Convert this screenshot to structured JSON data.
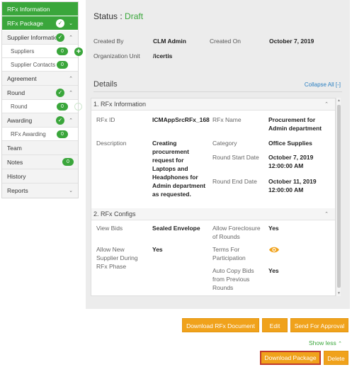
{
  "sidebar": {
    "rfx_information": "RFx Information",
    "rfx_package": "RFx Package",
    "supplier_information": "Supplier Information",
    "suppliers": {
      "label": "Suppliers",
      "count": "0"
    },
    "supplier_contacts": {
      "label": "Supplier Contacts",
      "count": "0"
    },
    "agreement": "Agreement",
    "round": "Round",
    "round_sub": {
      "label": "Round",
      "count": "0"
    },
    "awarding": "Awarding",
    "rfx_awarding": {
      "label": "RFx Awarding",
      "count": "0"
    },
    "team": "Team",
    "notes": {
      "label": "Notes",
      "count": "0"
    },
    "history": "History",
    "reports": "Reports"
  },
  "status": {
    "label": "Status :",
    "value": "Draft"
  },
  "meta": {
    "created_by_label": "Created By",
    "created_by": "CLM Admin",
    "created_on_label": "Created On",
    "created_on": "October 7, 2019",
    "org_unit_label": "Organization Unit",
    "org_unit": "/icertis"
  },
  "details": {
    "title": "Details",
    "collapse_all": "Collapse All [-]",
    "rfx_information": {
      "title": "1. RFx Information",
      "rfx_id_label": "RFx ID",
      "rfx_id": "ICMAppSrcRFx_168",
      "rfx_name_label": "RFx Name",
      "rfx_name": "Procurement for Admin department",
      "description_label": "Description",
      "description": "Creating procurement request for Laptops and Headphones for Admin department as requested.",
      "category_label": "Category",
      "category": "Office Supplies",
      "round_start_label": "Round Start Date",
      "round_start": "October 7, 2019 12:00:00 AM",
      "round_end_label": "Round End Date",
      "round_end": "October 11, 2019 12:00:00 AM"
    },
    "rfx_configs": {
      "title": "2. RFx Configs",
      "view_bids_label": "View Bids",
      "view_bids": "Sealed Envelope",
      "allow_foreclosure_label": "Allow Foreclosure of Rounds",
      "allow_foreclosure": "Yes",
      "allow_new_supplier_label": "Allow New Supplier During RFx Phase",
      "allow_new_supplier": "Yes",
      "terms_label": "Terms For Participation",
      "auto_copy_label": "Auto Copy Bids from Previous Rounds",
      "auto_copy": "Yes"
    }
  },
  "actions": {
    "download_rfx": "Download RFx Document",
    "edit": "Edit",
    "send_approval": "Send For Approval",
    "show_less": "Show less",
    "download_package": "Download Package",
    "delete": "Delete"
  },
  "colors": {
    "green": "#3aa63b",
    "orange": "#f0a21b",
    "link": "#2a7fc1",
    "highlight": "#c0392b"
  }
}
